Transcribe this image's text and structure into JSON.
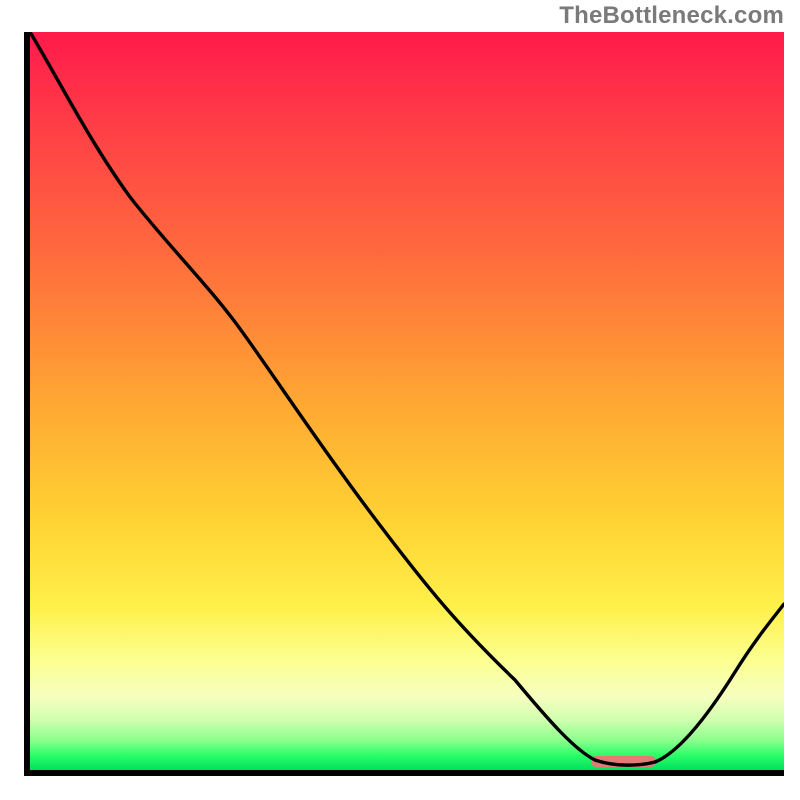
{
  "watermark": "TheBottleneck.com",
  "chart_data": {
    "type": "area-with-line",
    "title": "",
    "xlabel": "",
    "ylabel": "",
    "xlim": [
      0,
      1
    ],
    "ylim": [
      0,
      1
    ],
    "background_gradient_stops": [
      {
        "pos": 0.0,
        "color": "#ff1a4b"
      },
      {
        "pos": 0.12,
        "color": "#ff3c47"
      },
      {
        "pos": 0.3,
        "color": "#ff6a3d"
      },
      {
        "pos": 0.5,
        "color": "#ffa733"
      },
      {
        "pos": 0.66,
        "color": "#ffd233"
      },
      {
        "pos": 0.78,
        "color": "#fff04a"
      },
      {
        "pos": 0.85,
        "color": "#fcff8f"
      },
      {
        "pos": 0.9,
        "color": "#f6ffbf"
      },
      {
        "pos": 0.93,
        "color": "#d4ffb0"
      },
      {
        "pos": 0.96,
        "color": "#8bff8d"
      },
      {
        "pos": 0.98,
        "color": "#2bff67"
      },
      {
        "pos": 1.0,
        "color": "#00e060"
      }
    ],
    "series": [
      {
        "name": "bottleneck-curve",
        "x": [
          0.0,
          0.07,
          0.13,
          0.2,
          0.265,
          0.35,
          0.45,
          0.55,
          0.64,
          0.7,
          0.745,
          0.82,
          0.87,
          0.93,
          1.0
        ],
        "y": [
          1.0,
          0.9,
          0.81,
          0.72,
          0.64,
          0.53,
          0.4,
          0.265,
          0.14,
          0.055,
          0.012,
          0.008,
          0.03,
          0.11,
          0.22
        ]
      }
    ],
    "trough_marker_x_range": [
      0.745,
      0.83
    ],
    "trough_marker_y": 0.006
  }
}
